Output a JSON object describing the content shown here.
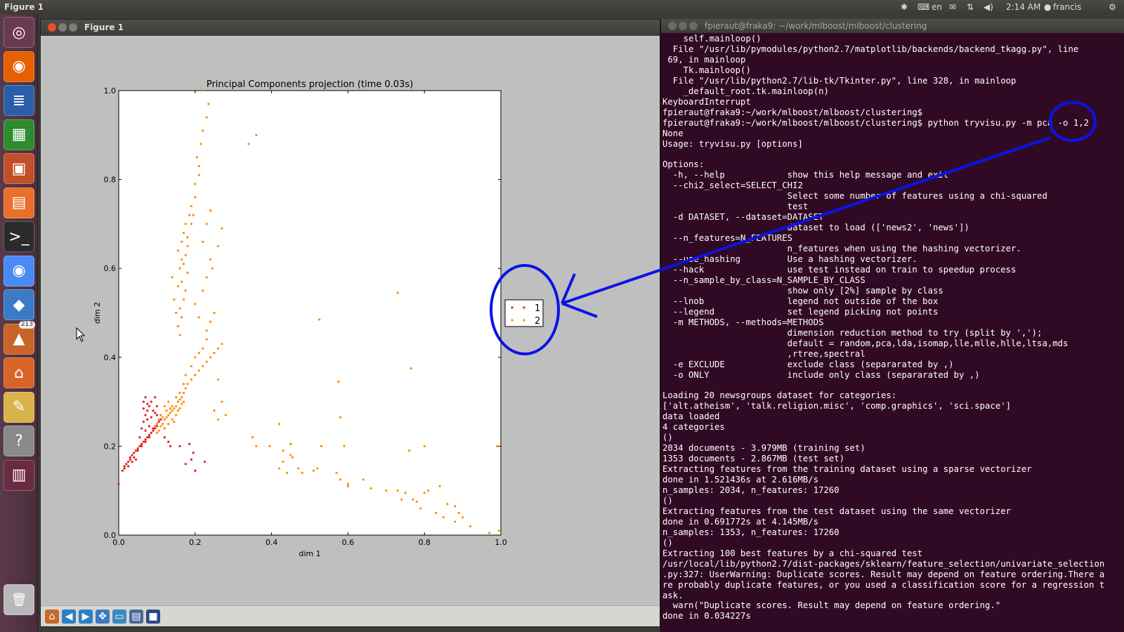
{
  "top_panel": {
    "window_title": "Figure 1",
    "keyboard": "en",
    "clock": "2:14 AM",
    "user": "francis"
  },
  "launcher": {
    "items": [
      {
        "name": "dash-home",
        "icon": "ubuntu-logo-icon",
        "color": "#6a3b50"
      },
      {
        "name": "firefox",
        "icon": "firefox-icon",
        "color": "#e66000"
      },
      {
        "name": "libreoffice-writer",
        "icon": "writer-icon",
        "color": "#2a5ea8"
      },
      {
        "name": "libreoffice-calc",
        "icon": "calc-icon",
        "color": "#2e8b2e"
      },
      {
        "name": "libreoffice-impress",
        "icon": "impress-icon",
        "color": "#c0502a"
      },
      {
        "name": "software-center",
        "icon": "software-center-icon",
        "color": "#e8702a"
      },
      {
        "name": "terminal",
        "icon": "terminal-icon",
        "color": "#2b2b2b"
      },
      {
        "name": "chrome",
        "icon": "chrome-icon",
        "color": "#4a8af4"
      },
      {
        "name": "virtualbox",
        "icon": "virtualbox-icon",
        "color": "#3a7bc8"
      },
      {
        "name": "update-manager",
        "icon": "update-manager-icon",
        "color": "#c8642a",
        "badge": "213"
      },
      {
        "name": "home-folder",
        "icon": "home-folder-icon",
        "color": "#d9642a"
      },
      {
        "name": "pencil-tool",
        "icon": "pencil-icon",
        "color": "#d8b24a"
      },
      {
        "name": "help",
        "icon": "help-icon",
        "color": "#8a8a8a"
      },
      {
        "name": "workspace-switcher",
        "icon": "workspace-switcher-icon",
        "color": "#6a2a40"
      }
    ],
    "trash": {
      "icon": "trash-icon"
    }
  },
  "figure_window": {
    "title": "Figure 1",
    "toolbar": [
      {
        "name": "home-button",
        "icon": "home-icon",
        "glyph": "⌂"
      },
      {
        "name": "back-button",
        "icon": "arrow-left-icon",
        "glyph": "◀"
      },
      {
        "name": "forward-button",
        "icon": "arrow-right-icon",
        "glyph": "▶"
      },
      {
        "name": "pan-button",
        "icon": "pan-icon",
        "glyph": "✥"
      },
      {
        "name": "zoom-button",
        "icon": "zoom-rect-icon",
        "glyph": "▭"
      },
      {
        "name": "subplots-button",
        "icon": "subplots-icon",
        "glyph": "▤"
      },
      {
        "name": "save-button",
        "icon": "save-icon",
        "glyph": "■"
      }
    ]
  },
  "chart_data": {
    "type": "scatter",
    "title": "Principal Components projection (time 0.03s)",
    "xlabel": "dim 1",
    "ylabel": "dim 2",
    "xlim": [
      0.0,
      1.0
    ],
    "ylim": [
      0.0,
      1.0
    ],
    "xticks": [
      "0.0",
      "0.2",
      "0.4",
      "0.6",
      "0.8",
      "1.0"
    ],
    "yticks": [
      "0.0",
      "0.2",
      "0.4",
      "0.6",
      "0.8",
      "1.0"
    ],
    "grid": false,
    "legend_position": "outside-right",
    "series": [
      {
        "name": "1",
        "color": "#e02020",
        "points": [
          [
            0.0,
            0.115
          ],
          [
            0.01,
            0.145
          ],
          [
            0.015,
            0.155
          ],
          [
            0.02,
            0.16
          ],
          [
            0.025,
            0.165
          ],
          [
            0.03,
            0.17
          ],
          [
            0.03,
            0.175
          ],
          [
            0.035,
            0.18
          ],
          [
            0.04,
            0.175
          ],
          [
            0.04,
            0.185
          ],
          [
            0.045,
            0.19
          ],
          [
            0.05,
            0.19
          ],
          [
            0.05,
            0.195
          ],
          [
            0.055,
            0.2
          ],
          [
            0.06,
            0.2
          ],
          [
            0.06,
            0.205
          ],
          [
            0.065,
            0.21
          ],
          [
            0.07,
            0.21
          ],
          [
            0.07,
            0.215
          ],
          [
            0.075,
            0.22
          ],
          [
            0.08,
            0.22
          ],
          [
            0.08,
            0.225
          ],
          [
            0.085,
            0.23
          ],
          [
            0.09,
            0.235
          ],
          [
            0.09,
            0.24
          ],
          [
            0.095,
            0.24
          ],
          [
            0.1,
            0.245
          ],
          [
            0.1,
            0.25
          ],
          [
            0.105,
            0.255
          ],
          [
            0.11,
            0.26
          ],
          [
            0.055,
            0.22
          ],
          [
            0.06,
            0.24
          ],
          [
            0.065,
            0.255
          ],
          [
            0.07,
            0.235
          ],
          [
            0.075,
            0.26
          ],
          [
            0.08,
            0.245
          ],
          [
            0.085,
            0.265
          ],
          [
            0.07,
            0.27
          ],
          [
            0.075,
            0.28
          ],
          [
            0.08,
            0.29
          ],
          [
            0.085,
            0.3
          ],
          [
            0.09,
            0.28
          ],
          [
            0.095,
            0.275
          ],
          [
            0.1,
            0.27
          ],
          [
            0.065,
            0.3
          ],
          [
            0.07,
            0.31
          ],
          [
            0.075,
            0.295
          ],
          [
            0.065,
            0.285
          ],
          [
            0.1,
            0.29
          ],
          [
            0.095,
            0.31
          ],
          [
            0.185,
            0.205
          ],
          [
            0.195,
            0.185
          ],
          [
            0.2,
            0.145
          ],
          [
            0.225,
            0.165
          ],
          [
            0.175,
            0.16
          ],
          [
            0.19,
            0.17
          ],
          [
            0.16,
            0.2
          ],
          [
            0.12,
            0.22
          ],
          [
            0.13,
            0.21
          ],
          [
            0.135,
            0.2
          ],
          [
            0.025,
            0.155
          ],
          [
            0.035,
            0.165
          ],
          [
            0.045,
            0.17
          ],
          [
            0.015,
            0.15
          ]
        ]
      },
      {
        "name": "2",
        "color": "#ff8c00",
        "points": [
          [
            0.1,
            0.23
          ],
          [
            0.105,
            0.235
          ],
          [
            0.11,
            0.245
          ],
          [
            0.115,
            0.25
          ],
          [
            0.12,
            0.26
          ],
          [
            0.125,
            0.265
          ],
          [
            0.13,
            0.27
          ],
          [
            0.135,
            0.275
          ],
          [
            0.14,
            0.28
          ],
          [
            0.145,
            0.285
          ],
          [
            0.15,
            0.29
          ],
          [
            0.155,
            0.3
          ],
          [
            0.16,
            0.305
          ],
          [
            0.165,
            0.31
          ],
          [
            0.17,
            0.32
          ],
          [
            0.175,
            0.33
          ],
          [
            0.18,
            0.34
          ],
          [
            0.19,
            0.35
          ],
          [
            0.2,
            0.36
          ],
          [
            0.21,
            0.37
          ],
          [
            0.22,
            0.38
          ],
          [
            0.23,
            0.39
          ],
          [
            0.24,
            0.4
          ],
          [
            0.25,
            0.41
          ],
          [
            0.26,
            0.42
          ],
          [
            0.27,
            0.43
          ],
          [
            0.12,
            0.24
          ],
          [
            0.13,
            0.25
          ],
          [
            0.14,
            0.26
          ],
          [
            0.145,
            0.255
          ],
          [
            0.115,
            0.265
          ],
          [
            0.125,
            0.28
          ],
          [
            0.135,
            0.285
          ],
          [
            0.14,
            0.29
          ],
          [
            0.15,
            0.27
          ],
          [
            0.155,
            0.28
          ],
          [
            0.16,
            0.285
          ],
          [
            0.165,
            0.295
          ],
          [
            0.17,
            0.3
          ],
          [
            0.13,
            0.3
          ],
          [
            0.12,
            0.29
          ],
          [
            0.11,
            0.27
          ],
          [
            0.105,
            0.26
          ],
          [
            0.1,
            0.25
          ],
          [
            0.095,
            0.245
          ],
          [
            0.15,
            0.31
          ],
          [
            0.16,
            0.32
          ],
          [
            0.17,
            0.34
          ],
          [
            0.175,
            0.36
          ],
          [
            0.19,
            0.38
          ],
          [
            0.2,
            0.4
          ],
          [
            0.21,
            0.41
          ],
          [
            0.22,
            0.42
          ],
          [
            0.23,
            0.44
          ],
          [
            0.16,
            0.45
          ],
          [
            0.155,
            0.47
          ],
          [
            0.165,
            0.49
          ],
          [
            0.16,
            0.51
          ],
          [
            0.17,
            0.53
          ],
          [
            0.175,
            0.55
          ],
          [
            0.165,
            0.57
          ],
          [
            0.18,
            0.59
          ],
          [
            0.17,
            0.61
          ],
          [
            0.175,
            0.63
          ],
          [
            0.18,
            0.65
          ],
          [
            0.165,
            0.66
          ],
          [
            0.17,
            0.68
          ],
          [
            0.175,
            0.7
          ],
          [
            0.185,
            0.72
          ],
          [
            0.19,
            0.74
          ],
          [
            0.2,
            0.76
          ],
          [
            0.2,
            0.79
          ],
          [
            0.21,
            0.81
          ],
          [
            0.21,
            0.83
          ],
          [
            0.205,
            0.85
          ],
          [
            0.215,
            0.88
          ],
          [
            0.22,
            0.91
          ],
          [
            0.23,
            0.94
          ],
          [
            0.235,
            0.97
          ],
          [
            0.22,
            1.0
          ],
          [
            0.15,
            0.5
          ],
          [
            0.145,
            0.53
          ],
          [
            0.155,
            0.56
          ],
          [
            0.14,
            0.58
          ],
          [
            0.16,
            0.6
          ],
          [
            0.165,
            0.62
          ],
          [
            0.155,
            0.64
          ],
          [
            0.18,
            0.67
          ],
          [
            0.19,
            0.7
          ],
          [
            0.195,
            0.72
          ],
          [
            0.23,
            0.46
          ],
          [
            0.24,
            0.48
          ],
          [
            0.25,
            0.5
          ],
          [
            0.23,
            0.58
          ],
          [
            0.24,
            0.62
          ],
          [
            0.26,
            0.65
          ],
          [
            0.22,
            0.66
          ],
          [
            0.23,
            0.7
          ],
          [
            0.24,
            0.73
          ],
          [
            0.27,
            0.69
          ],
          [
            0.245,
            0.6
          ],
          [
            0.22,
            0.55
          ],
          [
            0.2,
            0.52
          ],
          [
            0.21,
            0.49
          ],
          [
            0.26,
            0.35
          ],
          [
            0.27,
            0.3
          ],
          [
            0.25,
            0.28
          ],
          [
            0.28,
            0.27
          ],
          [
            0.26,
            0.26
          ],
          [
            0.34,
            0.88
          ],
          [
            0.36,
            0.9
          ],
          [
            0.73,
            0.545
          ],
          [
            0.525,
            0.485
          ],
          [
            0.765,
            0.375
          ],
          [
            0.575,
            0.345
          ],
          [
            0.58,
            0.265
          ],
          [
            0.42,
            0.25
          ],
          [
            0.35,
            0.22
          ],
          [
            0.45,
            0.205
          ],
          [
            0.53,
            0.2
          ],
          [
            0.59,
            0.2
          ],
          [
            0.395,
            0.2
          ],
          [
            0.36,
            0.2
          ],
          [
            0.43,
            0.19
          ],
          [
            0.45,
            0.18
          ],
          [
            0.455,
            0.175
          ],
          [
            0.43,
            0.165
          ],
          [
            0.42,
            0.15
          ],
          [
            0.44,
            0.14
          ],
          [
            0.47,
            0.15
          ],
          [
            0.51,
            0.145
          ],
          [
            0.52,
            0.15
          ],
          [
            0.48,
            0.14
          ],
          [
            0.57,
            0.14
          ],
          [
            0.58,
            0.125
          ],
          [
            0.6,
            0.115
          ],
          [
            0.6,
            0.11
          ],
          [
            0.64,
            0.125
          ],
          [
            0.66,
            0.105
          ],
          [
            0.7,
            0.1
          ],
          [
            0.73,
            0.1
          ],
          [
            0.75,
            0.095
          ],
          [
            0.77,
            0.08
          ],
          [
            0.78,
            0.075
          ],
          [
            0.79,
            0.06
          ],
          [
            0.8,
            0.095
          ],
          [
            0.81,
            0.1
          ],
          [
            0.83,
            0.05
          ],
          [
            0.86,
            0.07
          ],
          [
            0.88,
            0.065
          ],
          [
            0.9,
            0.04
          ],
          [
            0.92,
            0.02
          ],
          [
            0.85,
            0.04
          ],
          [
            0.89,
            0.05
          ],
          [
            0.84,
            0.11
          ],
          [
            0.8,
            0.2
          ],
          [
            0.76,
            0.19
          ],
          [
            0.99,
            0.2
          ],
          [
            0.97,
            0.005
          ],
          [
            0.995,
            0.01
          ],
          [
            0.88,
            0.03
          ],
          [
            0.74,
            0.08
          ]
        ]
      }
    ]
  },
  "terminal": {
    "title": "fpieraut@fraka9: ~/work/mlboost/mlboost/clustering",
    "lines": [
      "    self.mainloop()",
      "  File \"/usr/lib/pymodules/python2.7/matplotlib/backends/backend_tkagg.py\", line",
      " 69, in mainloop",
      "    Tk.mainloop()",
      "  File \"/usr/lib/python2.7/lib-tk/Tkinter.py\", line 328, in mainloop",
      "    _default_root.tk.mainloop(n)",
      "KeyboardInterrupt",
      "fpieraut@fraka9:~/work/mlboost/mlboost/clustering$",
      "fpieraut@fraka9:~/work/mlboost/mlboost/clustering$ python tryvisu.py -m pca -o 1,2",
      "None",
      "Usage: tryvisu.py [options]",
      "",
      "Options:",
      "  -h, --help            show this help message and exit",
      "  --chi2_select=SELECT_CHI2",
      "                        Select some number of features using a chi-squared",
      "                        test",
      "  -d DATASET, --dataset=DATASET",
      "                        dataset to load (['news2', 'news'])",
      "  --n_features=N_FEATURES",
      "                        n_features when using the hashing vectorizer.",
      "  --use_hashing         Use a hashing vectorizer.",
      "  --hack                use test instead on train to speedup process",
      "  --n_sample_by_class=N_SAMPLE_BY_CLASS",
      "                        show only [2%] sample by class",
      "  --lnob                legend not outside of the box",
      "  --legend              set legend picking not points",
      "  -m METHODS, --methods=METHODS",
      "                        dimension reduction method to try (split by ',');",
      "                        default = random,pca,lda,isomap,lle,mlle,hlle,ltsa,mds",
      "                        ,rtree,spectral",
      "  -e EXCLUDE            exclude class (separarated by ,)",
      "  -o ONLY               include only class (separarated by ,)",
      "",
      "Loading 20 newsgroups dataset for categories:",
      "['alt.atheism', 'talk.religion.misc', 'comp.graphics', 'sci.space']",
      "data loaded",
      "4 categories",
      "()",
      "2034 documents - 3.979MB (training set)",
      "1353 documents - 2.867MB (test set)",
      "Extracting features from the training dataset using a sparse vectorizer",
      "done in 1.521436s at 2.616MB/s",
      "n_samples: 2034, n_features: 17260",
      "()",
      "Extracting features from the test dataset using the same vectorizer",
      "done in 0.691772s at 4.145MB/s",
      "n_samples: 1353, n_features: 17260",
      "()",
      "Extracting 100 best features by a chi-squared test",
      "/usr/local/lib/python2.7/dist-packages/sklearn/feature_selection/univariate_selection",
      ".py:327: UserWarning: Duplicate scores. Result may depend on feature ordering.There a",
      "re probably duplicate features, or you used a classification score for a regression t",
      "ask.",
      "  warn(\"Duplicate scores. Result may depend on feature ordering.\"",
      "done in 0.034227s"
    ]
  },
  "annotation": {
    "color": "#0a14e6"
  }
}
